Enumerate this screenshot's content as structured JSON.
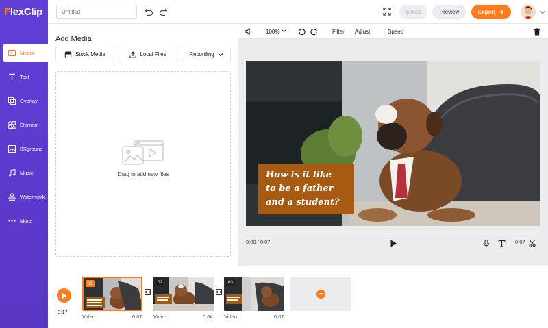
{
  "app": {
    "logo_first": "F",
    "logo_rest": "lexClip"
  },
  "sidebar": {
    "items": [
      {
        "label": "Media",
        "icon": "media-icon"
      },
      {
        "label": "Text",
        "icon": "text-icon"
      },
      {
        "label": "Overlay",
        "icon": "overlay-icon"
      },
      {
        "label": "Element",
        "icon": "element-icon"
      },
      {
        "label": "BKground",
        "icon": "background-icon"
      },
      {
        "label": "Music",
        "icon": "music-icon"
      },
      {
        "label": "Watermark",
        "icon": "watermark-icon"
      },
      {
        "label": "More",
        "icon": "more-icon"
      }
    ]
  },
  "topbar": {
    "title_placeholder": "Untitled",
    "saved_label": "Saved",
    "preview_label": "Preview",
    "export_label": "Export"
  },
  "panel": {
    "title": "Add Media",
    "stock_label": "Stock Media",
    "local_label": "Local Files",
    "recording_label": "Recording",
    "drop_text": "Drag to add new files"
  },
  "preview": {
    "zoom": "100%",
    "filter_label": "Filter",
    "adjust_label": "Adjust",
    "speed_label": "Speed",
    "caption_lines": [
      "How is it like",
      "to be a father",
      "and a student?"
    ],
    "current_time": "0:00 / 0:07",
    "clip_duration": "0:07"
  },
  "timeline": {
    "total_time": "0:17",
    "clips": [
      {
        "num": "01",
        "type": "Video",
        "duration": "0:07"
      },
      {
        "num": "02",
        "type": "Video",
        "duration": "0:04"
      },
      {
        "num": "03",
        "type": "Video",
        "duration": "0:07"
      }
    ]
  },
  "colors": {
    "accent": "#ff7b1c",
    "sidebar": "#5f3fd6",
    "caption_bg": "#a75a12"
  }
}
